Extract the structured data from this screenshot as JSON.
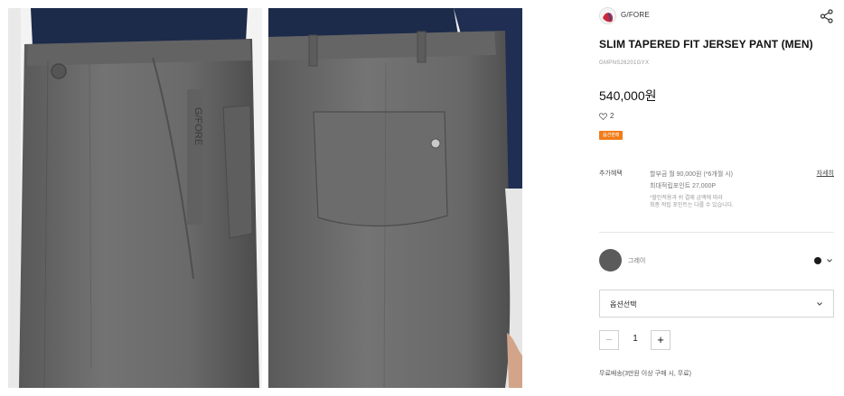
{
  "product_images": [
    {
      "name": "front-pocket-closeup",
      "logo_text": "G/FORE"
    },
    {
      "name": "back-pocket-closeup"
    }
  ],
  "brand": {
    "name": "G/FORE"
  },
  "product": {
    "title": "SLIM TAPERED FIT JERSEY PANT (MEN)",
    "code": "GMPNS26201GYX",
    "price": "540,000원",
    "likes": "2",
    "badge": "옵션판매"
  },
  "benefits": {
    "label": "추가혜택",
    "installment": "할부금 월 90,000원 (*6개월 시)",
    "points": "최대적립포인트 27,000P",
    "note_line1": "*할인적용과 쉬 결제 금액에 따라",
    "note_line2": "최종 적립 포인트는 다를 수 있습니다.",
    "detail_link": "자세히"
  },
  "color": {
    "name": "그레이",
    "swatch": "#5b5b5b",
    "dot": "#1b1b1b"
  },
  "option_select": {
    "label": "옵션선택"
  },
  "quantity": {
    "minus": "−",
    "value": "1",
    "plus": "+"
  },
  "shipping": "무료배송(3만원 이상 구매 시, 무료)",
  "colors": {
    "badge_orange": "#f07c1a",
    "navy_shirt": "#1d2b4a",
    "pant_gray": "#6b6b6b"
  },
  "icons": [
    "brand-logo-icon",
    "share-icon",
    "heart-icon",
    "chevron-down-icon"
  ]
}
